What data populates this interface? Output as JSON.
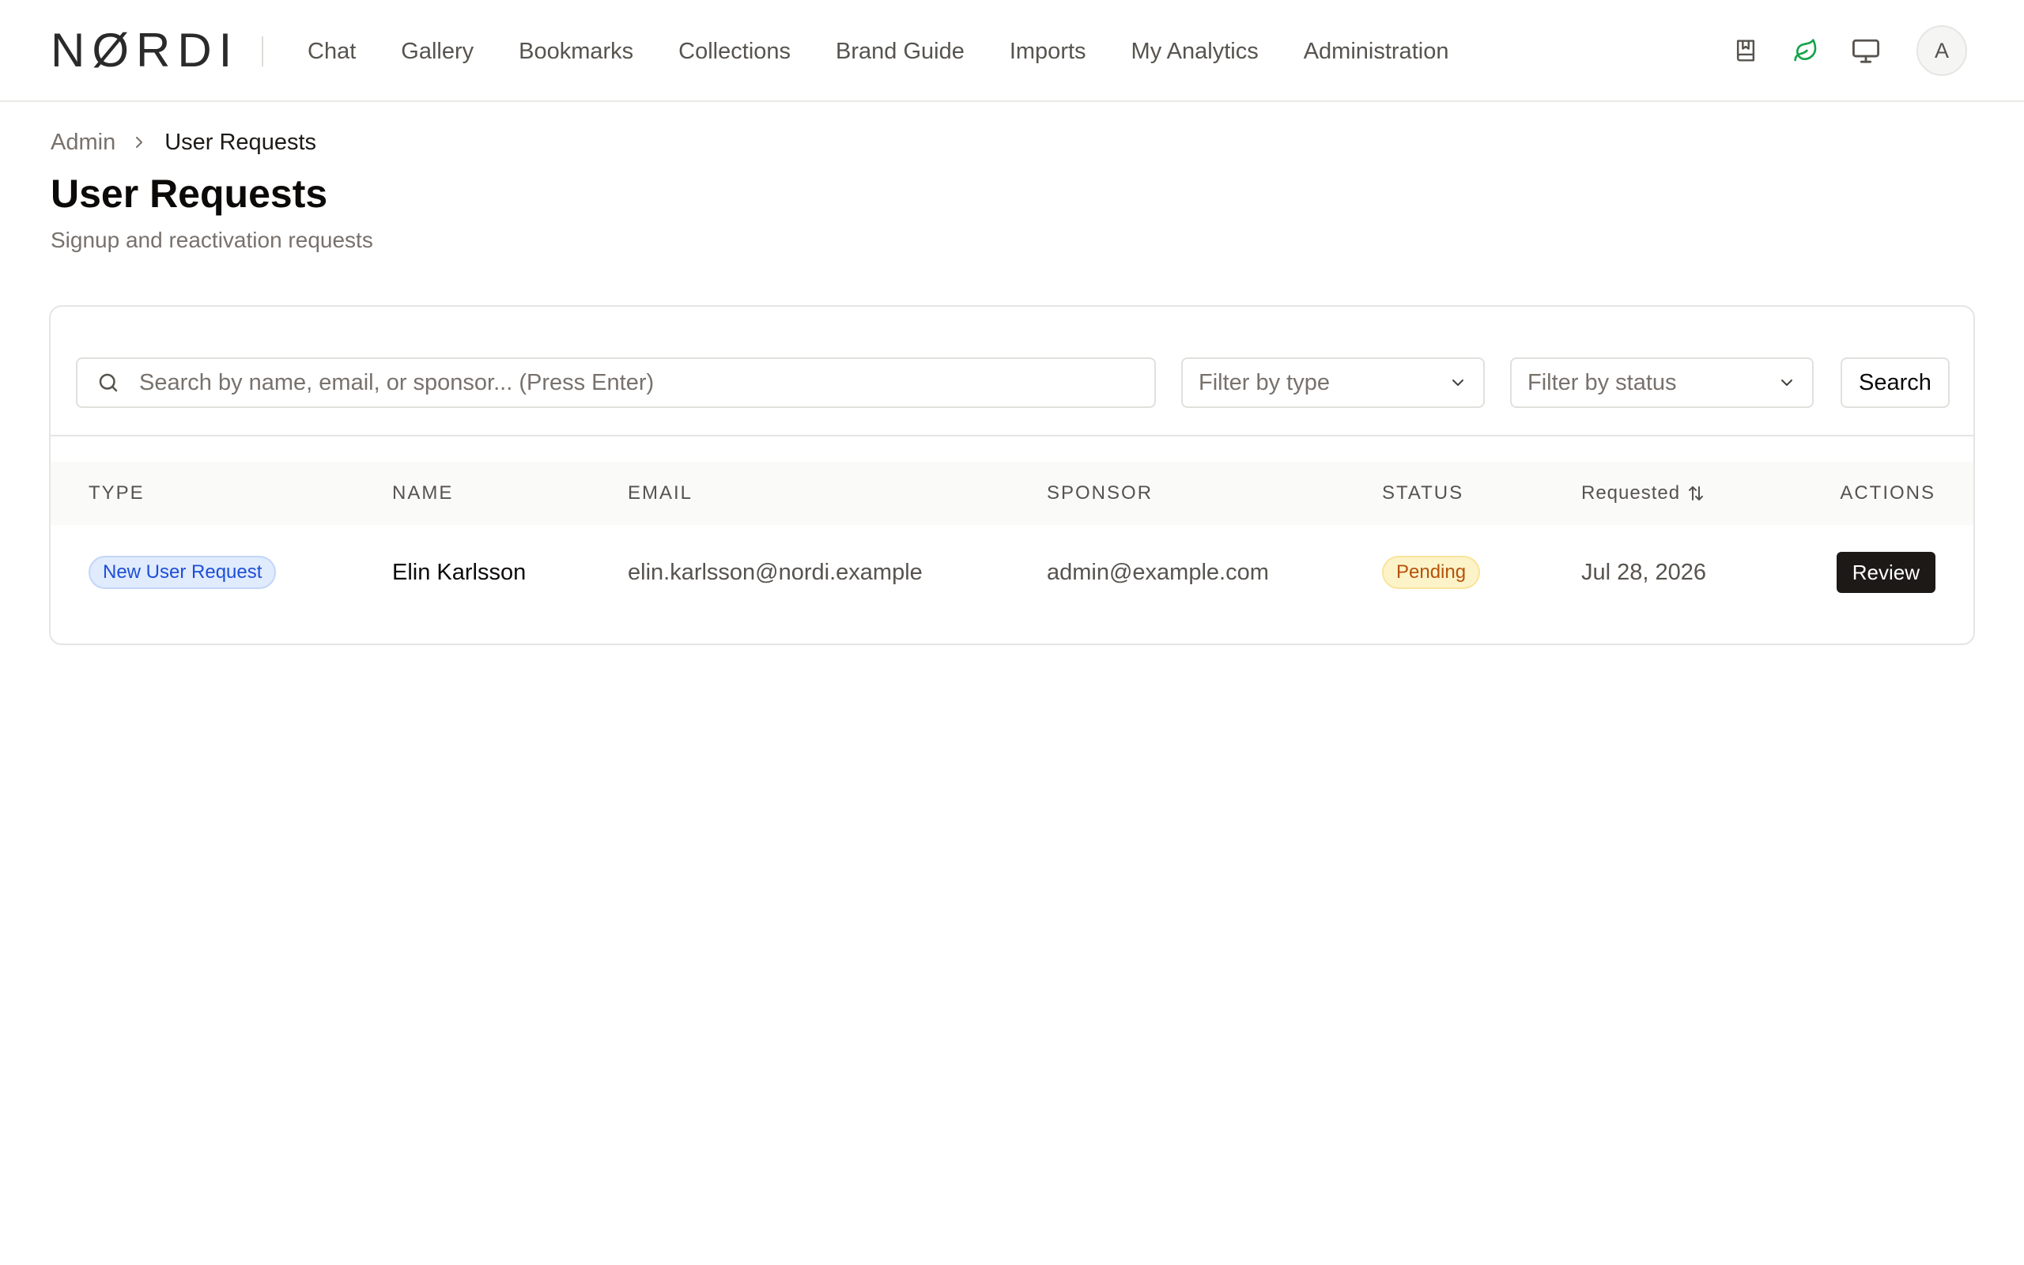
{
  "brand": {
    "logo_text": "NØRDI"
  },
  "nav": {
    "items": [
      {
        "label": "Chat"
      },
      {
        "label": "Gallery"
      },
      {
        "label": "Bookmarks"
      },
      {
        "label": "Collections"
      },
      {
        "label": "Brand Guide"
      },
      {
        "label": "Imports"
      },
      {
        "label": "My Analytics"
      },
      {
        "label": "Administration"
      }
    ],
    "icons": [
      "bookmark-book-icon",
      "leaf-icon",
      "monitor-icon"
    ],
    "avatar_initial": "A"
  },
  "breadcrumb": {
    "root": "Admin",
    "current": "User Requests"
  },
  "page": {
    "title": "User Requests",
    "subtitle": "Signup and reactivation requests"
  },
  "toolbar": {
    "search_placeholder": "Search by name, email, or sponsor... (Press Enter)",
    "search_value": "",
    "type_filter": "Filter by type",
    "status_filter": "Filter by status",
    "search_button": "Search"
  },
  "table": {
    "columns": {
      "type": "TYPE",
      "name": "NAME",
      "email": "EMAIL",
      "sponsor": "SPONSOR",
      "status": "STATUS",
      "requested": "Requested",
      "actions": "ACTIONS"
    },
    "rows": [
      {
        "type": "New User Request",
        "name": "Elin Karlsson",
        "email": "elin.karlsson@nordi.example",
        "sponsor": "admin@example.com",
        "status": "Pending",
        "requested": "Jul 28, 2026",
        "action": "Review"
      }
    ]
  },
  "colors": {
    "accent_leaf": "#16a34a",
    "type_badge": "#1d4ed8",
    "status_pending": "#b45309",
    "primary_button": "#1c1917"
  }
}
